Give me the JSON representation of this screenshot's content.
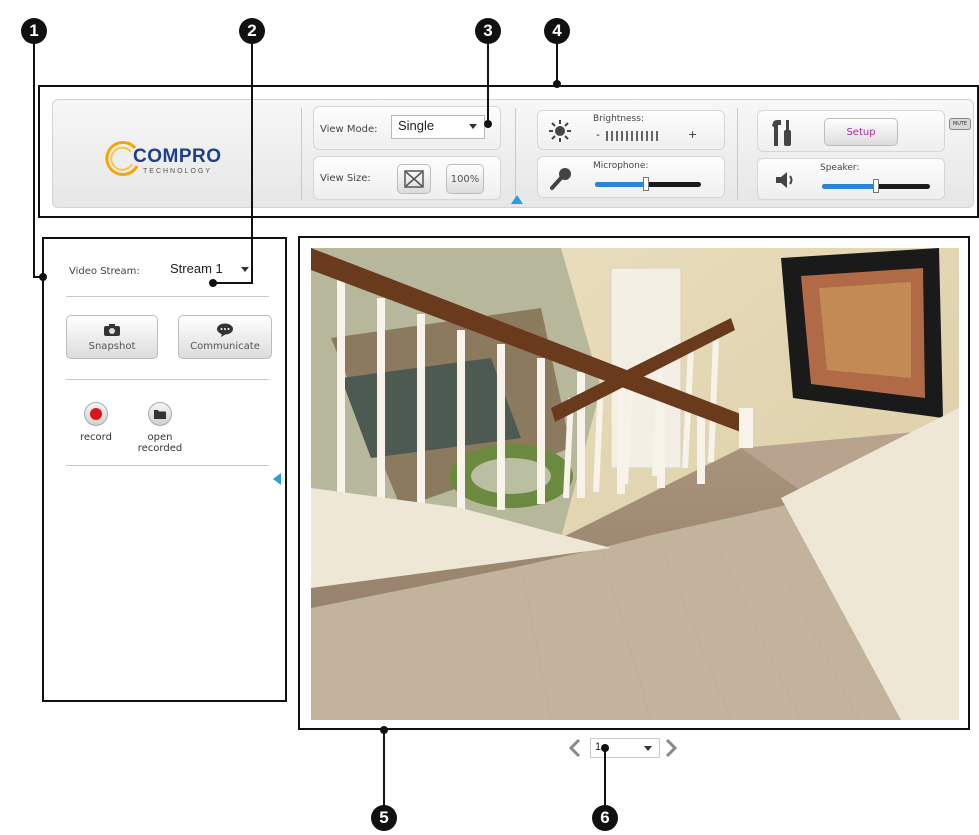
{
  "callouts": [
    "1",
    "2",
    "3",
    "4",
    "5",
    "6"
  ],
  "logo": {
    "name": "COMPRO",
    "sub": "TECHNOLOGY"
  },
  "view_mode": {
    "label": "View Mode:",
    "value": "Single"
  },
  "view_size": {
    "label": "View Size:",
    "fit_icon": "fit-screen-icon",
    "zoom_label": "100%"
  },
  "brightness": {
    "label": "Brightness:",
    "minus": "-",
    "plus": "+",
    "icon": "sun-icon",
    "level": 0.5
  },
  "microphone": {
    "label": "Microphone:",
    "icon": "microphone-icon",
    "level": 0.48
  },
  "setup": {
    "label": "Setup",
    "icon": "tools-icon",
    "badge": "MUTE"
  },
  "speaker": {
    "label": "Speaker:",
    "icon": "speaker-icon",
    "level": 0.5
  },
  "left_panel": {
    "video_stream_label": "Video Stream:",
    "video_stream_value": "Stream 1",
    "snapshot_label": "Snapshot",
    "communicate_label": "Communicate",
    "record_label": "record",
    "open_recorded_label": "open recorded"
  },
  "pager": {
    "value": "1",
    "prev_icon": "chevron-left-icon",
    "next_icon": "chevron-right-icon"
  },
  "colors": {
    "accent_blue": "#2a86d8",
    "record_red": "#d9141e",
    "setup_text": "#b0299a"
  }
}
